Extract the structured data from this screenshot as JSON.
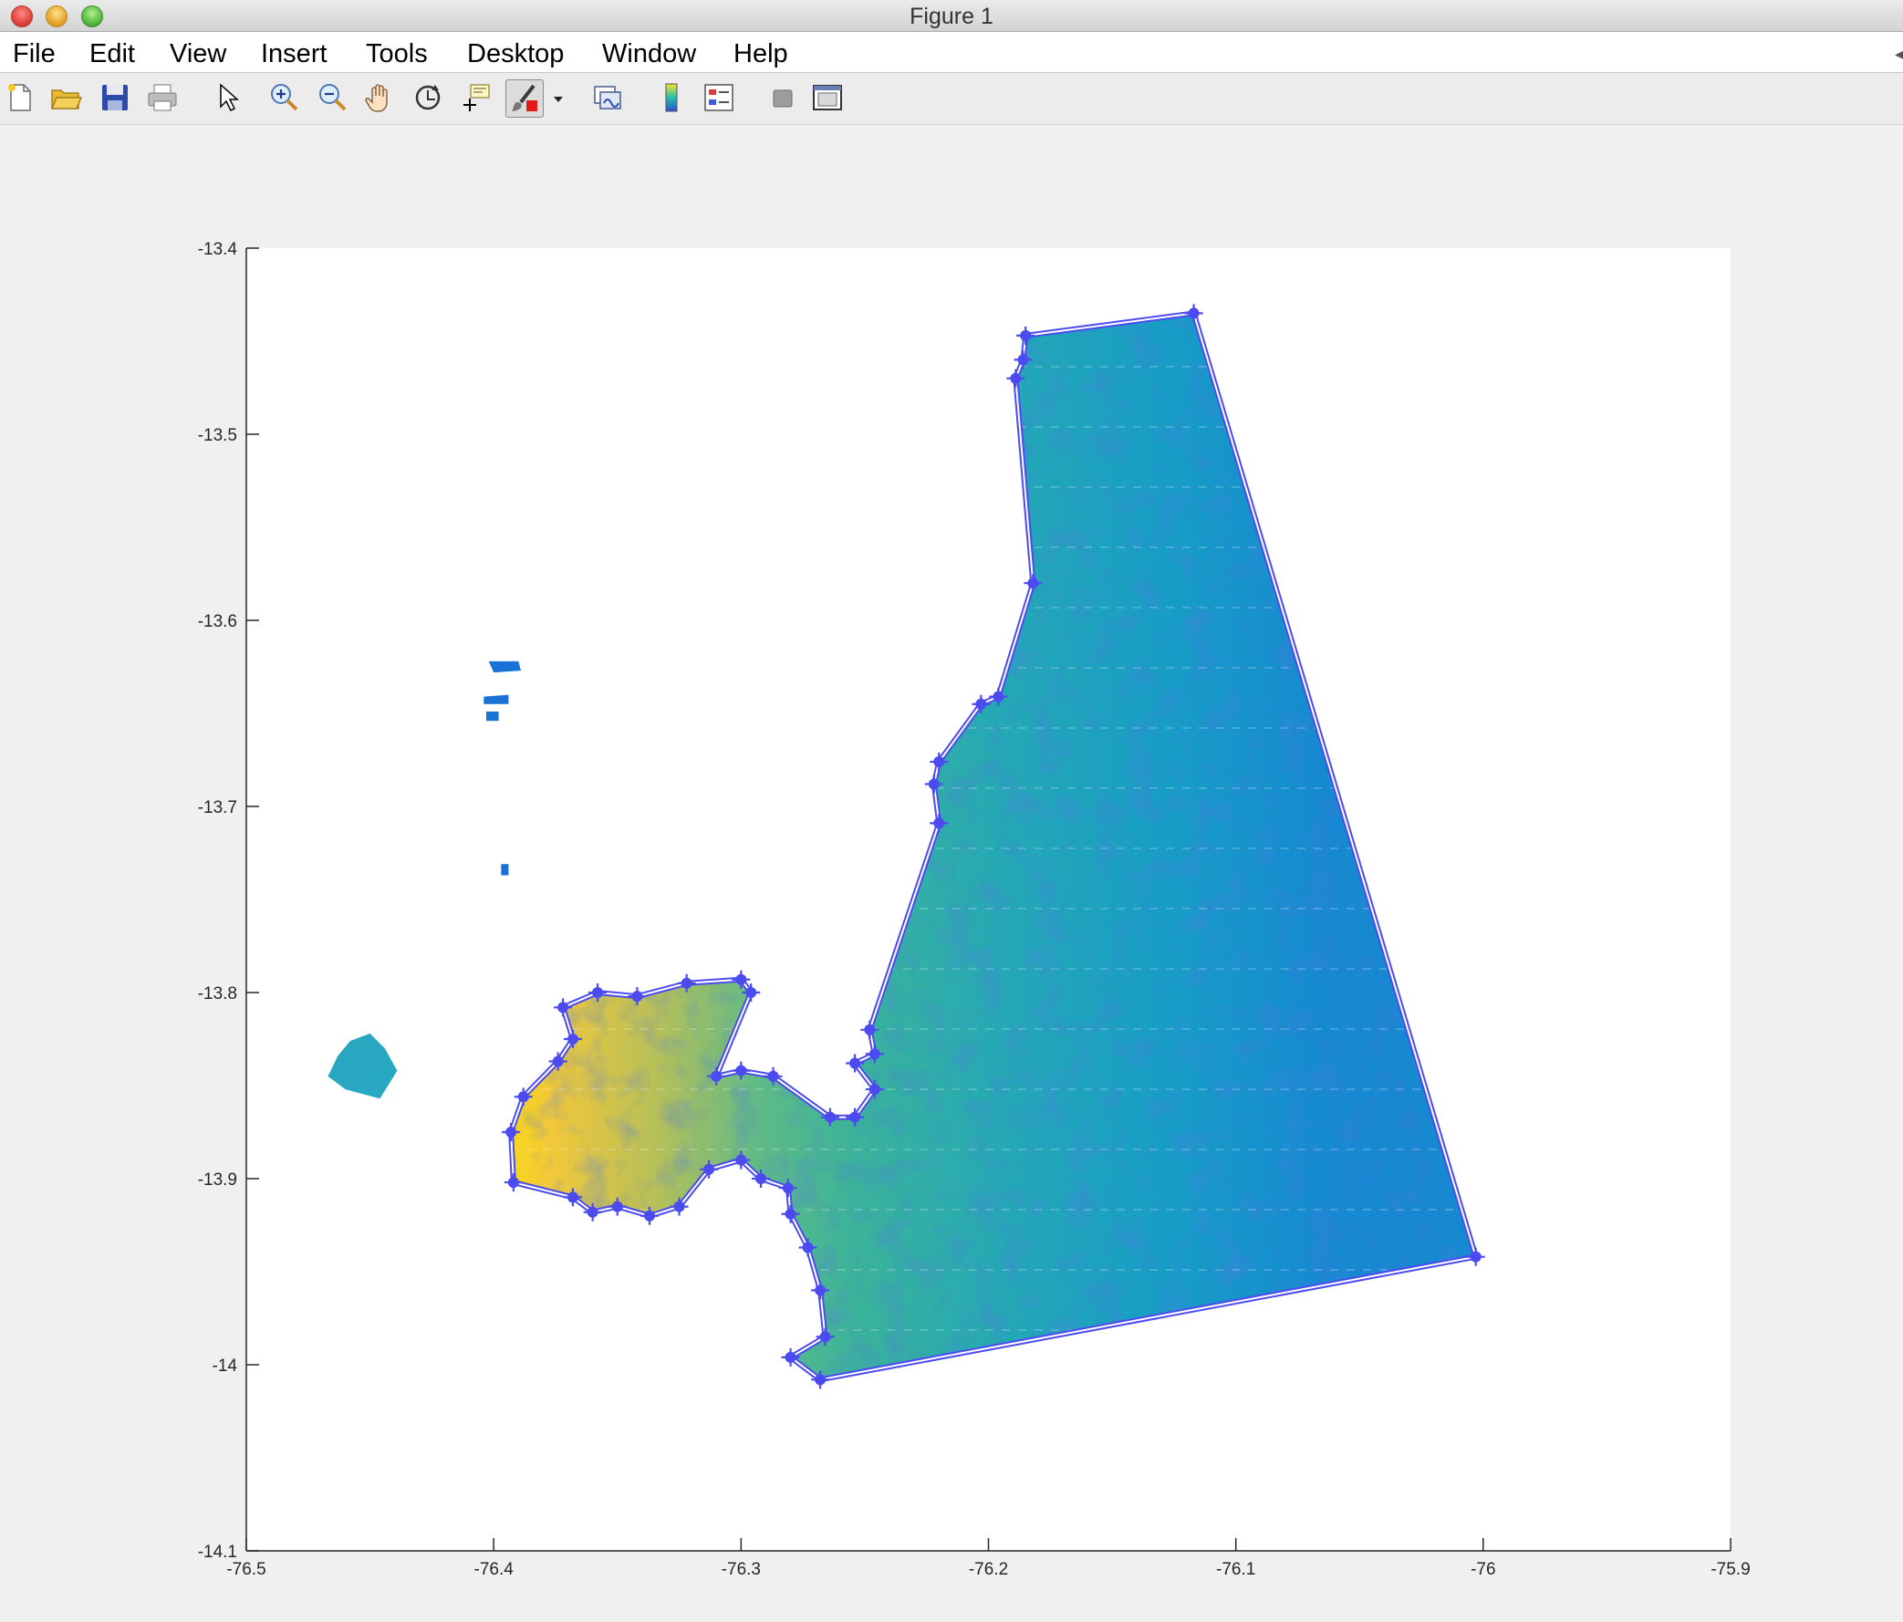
{
  "window": {
    "title": "Figure 1"
  },
  "menubar": {
    "items": [
      "File",
      "Edit",
      "View",
      "Insert",
      "Tools",
      "Desktop",
      "Window",
      "Help"
    ]
  },
  "toolbar": {
    "icons": [
      "new-figure-icon",
      "open-file-icon",
      "save-icon",
      "print-icon",
      "edit-plot-arrow-icon",
      "zoom-in-icon",
      "zoom-out-icon",
      "pan-hand-icon",
      "rotate-3d-icon",
      "data-cursor-icon",
      "brush-icon",
      "dropdown-arrow-icon",
      "link-plot-icon",
      "insert-colorbar-icon",
      "insert-legend-icon",
      "hide-plot-tools-icon",
      "show-plot-tools-icon"
    ]
  },
  "chart_data": {
    "type": "scatter",
    "title": "",
    "xlabel": "",
    "ylabel": "",
    "xlim": [
      -76.5,
      -75.9
    ],
    "ylim": [
      -14.1,
      -13.4
    ],
    "x_ticks": [
      "-76.5",
      "-76.4",
      "-76.3",
      "-76.2",
      "-76.1",
      "-76",
      "-75.9"
    ],
    "y_ticks": [
      "-13.4",
      "-13.5",
      "-13.6",
      "-13.7",
      "-13.8",
      "-13.9",
      "-14",
      "-14.1"
    ],
    "grid": false,
    "colormap": "parula",
    "colors": {
      "low": "#1a4fd6",
      "mid": "#12a0c6",
      "high": "#f7d61c",
      "polygon": "#4b4bf0"
    },
    "series": [
      {
        "type": "scatter-field",
        "regions": [
          {
            "polygon": [
              [
                -76.185,
                -13.447
              ],
              [
                -76.117,
                -13.435
              ],
              [
                -76.003,
                -13.942
              ],
              [
                -76.268,
                -14.008
              ],
              [
                -76.28,
                -13.996
              ],
              [
                -76.266,
                -13.985
              ],
              [
                -76.268,
                -13.96
              ],
              [
                -76.273,
                -13.937
              ],
              [
                -76.28,
                -13.919
              ],
              [
                -76.281,
                -13.905
              ],
              [
                -76.292,
                -13.9
              ],
              [
                -76.3,
                -13.89
              ],
              [
                -76.313,
                -13.895
              ],
              [
                -76.325,
                -13.915
              ],
              [
                -76.337,
                -13.92
              ],
              [
                -76.35,
                -13.915
              ],
              [
                -76.36,
                -13.918
              ],
              [
                -76.368,
                -13.91
              ],
              [
                -76.392,
                -13.902
              ],
              [
                -76.393,
                -13.875
              ],
              [
                -76.388,
                -13.856
              ],
              [
                -76.374,
                -13.837
              ],
              [
                -76.368,
                -13.825
              ],
              [
                -76.372,
                -13.808
              ],
              [
                -76.358,
                -13.8
              ],
              [
                -76.342,
                -13.802
              ],
              [
                -76.322,
                -13.795
              ],
              [
                -76.3,
                -13.793
              ],
              [
                -76.296,
                -13.8
              ],
              [
                -76.31,
                -13.845
              ],
              [
                -76.3,
                -13.842
              ],
              [
                -76.287,
                -13.845
              ],
              [
                -76.264,
                -13.867
              ],
              [
                -76.254,
                -13.867
              ],
              [
                -76.246,
                -13.852
              ],
              [
                -76.254,
                -13.838
              ],
              [
                -76.246,
                -13.833
              ],
              [
                -76.248,
                -13.82
              ],
              [
                -76.22,
                -13.709
              ],
              [
                -76.222,
                -13.688
              ],
              [
                -76.22,
                -13.676
              ],
              [
                -76.203,
                -13.645
              ],
              [
                -76.196,
                -13.641
              ],
              [
                -76.182,
                -13.58
              ],
              [
                -76.189,
                -13.47
              ],
              [
                -76.186,
                -13.46
              ]
            ]
          },
          {
            "polygon": [
              [
                -76.458,
                -13.826
              ],
              [
                -76.45,
                -13.822
              ],
              [
                -76.444,
                -13.83
              ],
              [
                -76.439,
                -13.842
              ],
              [
                -76.446,
                -13.857
              ],
              [
                -76.46,
                -13.852
              ],
              [
                -76.467,
                -13.845
              ],
              [
                -76.463,
                -13.834
              ]
            ]
          },
          {
            "polygon": [
              [
                -76.402,
                -13.622
              ],
              [
                -76.39,
                -13.622
              ],
              [
                -76.389,
                -13.627
              ],
              [
                -76.4,
                -13.628
              ]
            ]
          },
          {
            "polygon": [
              [
                -76.404,
                -13.641
              ],
              [
                -76.394,
                -13.64
              ],
              [
                -76.394,
                -13.645
              ],
              [
                -76.404,
                -13.645
              ]
            ]
          },
          {
            "polygon": [
              [
                -76.403,
                -13.649
              ],
              [
                -76.398,
                -13.649
              ],
              [
                -76.398,
                -13.654
              ],
              [
                -76.403,
                -13.654
              ]
            ]
          },
          {
            "polygon": [
              [
                -76.397,
                -13.731
              ],
              [
                -76.394,
                -13.731
              ],
              [
                -76.394,
                -13.737
              ],
              [
                -76.397,
                -13.737
              ]
            ]
          }
        ]
      },
      {
        "type": "line",
        "marker": "star",
        "x": [
          -76.185,
          -76.117,
          -76.003,
          -76.268,
          -76.28,
          -76.266,
          -76.268,
          -76.273,
          -76.28,
          -76.281,
          -76.292,
          -76.3,
          -76.313,
          -76.325,
          -76.337,
          -76.35,
          -76.36,
          -76.368,
          -76.392,
          -76.393,
          -76.388,
          -76.374,
          -76.368,
          -76.372,
          -76.358,
          -76.342,
          -76.322,
          -76.3,
          -76.296,
          -76.31,
          -76.3,
          -76.287,
          -76.264,
          -76.254,
          -76.246,
          -76.254,
          -76.246,
          -76.248,
          -76.22,
          -76.222,
          -76.22,
          -76.203,
          -76.196,
          -76.182,
          -76.189,
          -76.186,
          -76.185
        ],
        "y": [
          -13.447,
          -13.435,
          -13.942,
          -14.008,
          -13.996,
          -13.985,
          -13.96,
          -13.937,
          -13.919,
          -13.905,
          -13.9,
          -13.89,
          -13.895,
          -13.915,
          -13.92,
          -13.915,
          -13.918,
          -13.91,
          -13.902,
          -13.875,
          -13.856,
          -13.837,
          -13.825,
          -13.808,
          -13.8,
          -13.802,
          -13.795,
          -13.793,
          -13.8,
          -13.845,
          -13.842,
          -13.845,
          -13.867,
          -13.867,
          -13.852,
          -13.838,
          -13.833,
          -13.82,
          -13.709,
          -13.688,
          -13.676,
          -13.645,
          -13.641,
          -13.58,
          -13.47,
          -13.46,
          -13.447
        ]
      }
    ]
  }
}
